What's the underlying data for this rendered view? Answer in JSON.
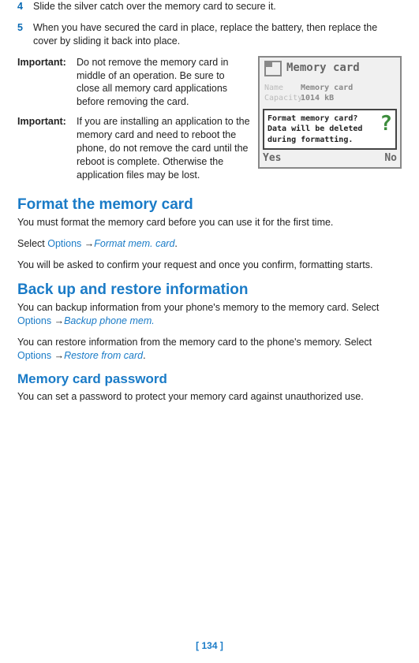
{
  "steps": {
    "n4": "4",
    "t4": "Slide the silver catch over the memory card to secure it.",
    "n5": "5",
    "t5": "When you have secured the card in place, replace the battery, then replace the cover by sliding it back into place."
  },
  "important": {
    "label": "Important:",
    "i1": "Do not remove the memory card in middle of an operation. Be sure to close all memory card applications before removing the card.",
    "i2": "If you are installing an application to the memory card and need to reboot the phone, do not remove the card until the reboot is complete. Otherwise the application files may be lost."
  },
  "phone": {
    "title": "Memory card",
    "name_label": "Name",
    "name_val": "Memory card",
    "cap_label": "Capacity",
    "cap_val": "1014 kB",
    "dialog": "Format memory card? Data will be deleted during formatting.",
    "q": "?",
    "yes": "Yes",
    "no": "No"
  },
  "sections": {
    "format_h": "Format the memory card",
    "format_p1": "You must format the memory card before you can use it for the first time.",
    "format_p2a": "Select ",
    "options": "Options",
    "arrow": " →",
    "format_cmd": "Format mem. card",
    "format_p3": "You will be asked to confirm your request and once you confirm, formatting starts.",
    "backup_h": "Back up and restore information",
    "backup_p1a": "You can backup information from your phone's memory to the memory card.  Select ",
    "backup_cmd": "Backup phone mem.",
    "backup_p2a": "You can restore information from the memory card to the phone's memory.  Select ",
    "restore_cmd": "Restore from card",
    "pwd_h": "Memory card password",
    "pwd_p": "You can set a password to protect your memory card against unauthorized use."
  },
  "page": "[ 134 ]"
}
